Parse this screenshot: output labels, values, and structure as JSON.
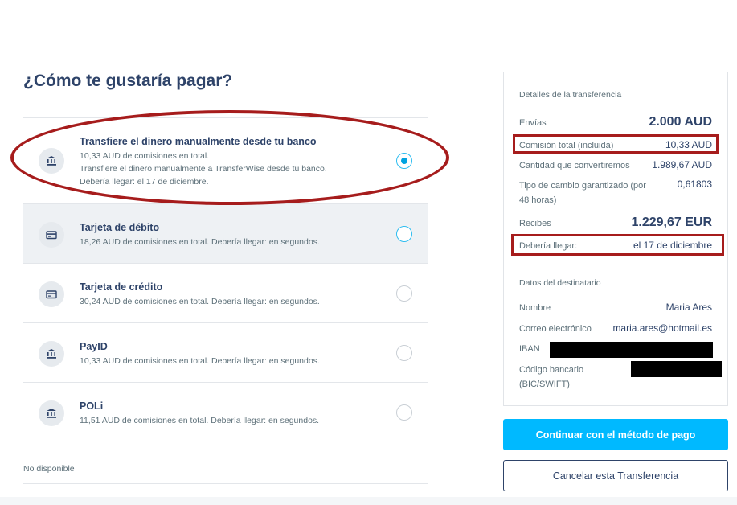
{
  "page": {
    "title": "¿Cómo te gustaría pagar?"
  },
  "options": [
    {
      "title": "Transfiere el dinero manualmente desde tu banco",
      "desc": [
        "10,33 AUD de comisiones en total.",
        "Transfiere el dinero manualmente a TransferWise desde tu banco.",
        "Debería llegar: el 17 de diciembre."
      ],
      "icon": "bank-icon",
      "selected": true
    },
    {
      "title": "Tarjeta de débito",
      "desc": [
        "18,26 AUD de comisiones en total. Debería llegar: en segundos."
      ],
      "icon": "card-icon",
      "selected": false
    },
    {
      "title": "Tarjeta de crédito",
      "desc": [
        "30,24 AUD de comisiones en total. Debería llegar: en segundos."
      ],
      "icon": "card-icon",
      "selected": false
    },
    {
      "title": "PayID",
      "desc": [
        "10,33 AUD de comisiones en total. Debería llegar: en segundos."
      ],
      "icon": "bank-icon",
      "selected": false
    },
    {
      "title": "POLi",
      "desc": [
        "11,51 AUD de comisiones en total. Debería llegar: en segundos."
      ],
      "icon": "bank-icon",
      "selected": false
    }
  ],
  "unavailable_label": "No disponible",
  "details": {
    "section_title": "Detalles de la transferencia",
    "send_label": "Envías",
    "send_value": "2.000 AUD",
    "fee_label": "Comisión total (incluida)",
    "fee_value": "10,33 AUD",
    "convert_label": "Cantidad que convertiremos",
    "convert_value": "1.989,67 AUD",
    "rate_label": "Tipo de cambio garantizado (por 48 horas)",
    "rate_value": "0,61803",
    "receive_label": "Recibes",
    "receive_value": "1.229,67 EUR",
    "arrival_label": "Debería llegar:",
    "arrival_value": "el 17 de diciembre"
  },
  "recipient": {
    "section_title": "Datos del destinatario",
    "name_label": "Nombre",
    "name_value": "Maria Ares",
    "email_label": "Correo electrónico",
    "email_value": "maria.ares@hotmail.es",
    "iban_label": "IBAN",
    "bic_label": "Código bancario (BIC/SWIFT)"
  },
  "buttons": {
    "continue": "Continuar con el método de pago",
    "cancel": "Cancelar esta Transferencia"
  },
  "colors": {
    "brand_blue": "#00b9ff",
    "navy": "#2e4369",
    "annotation_red": "#a61c1c"
  }
}
